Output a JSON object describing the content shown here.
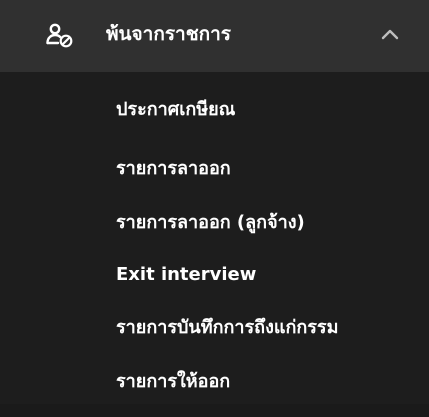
{
  "header": {
    "icon": "user-blocked-icon",
    "title": "พ้นจากราชการ",
    "expanded_indicator": "chevron-up-icon"
  },
  "submenu": {
    "items": [
      {
        "label": "ประกาศเกษียณ"
      },
      {
        "label": "รายการลาออก"
      },
      {
        "label": "รายการลาออก (ลูกจ้าง)"
      },
      {
        "label": "Exit interview"
      },
      {
        "label": "รายการบันทึกการถึงแก่กรรม"
      },
      {
        "label": "รายการให้ออก"
      }
    ]
  },
  "colors": {
    "header_bg": "#303030",
    "submenu_bg": "#1d1d1d",
    "text": "#ffffff",
    "chevron": "#bdbdbd"
  }
}
